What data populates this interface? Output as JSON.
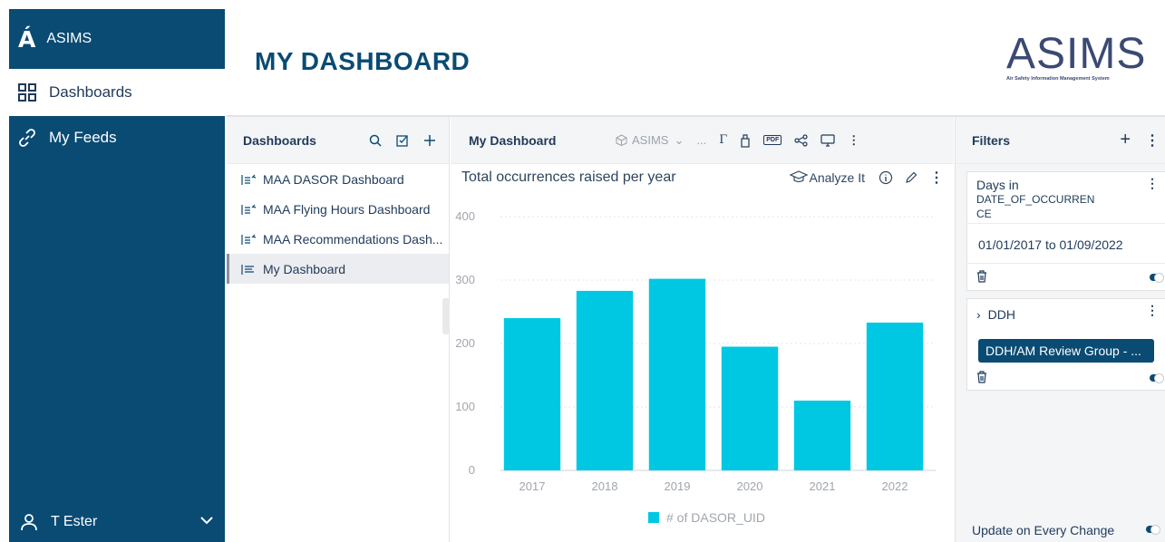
{
  "sidebar": {
    "brand": "ASIMS",
    "items": [
      {
        "label": "Dashboards",
        "icon": "grid-icon"
      },
      {
        "label": "My Feeds",
        "icon": "link-icon"
      }
    ],
    "user": "T Ester"
  },
  "header": {
    "title": "MY DASHBOARD",
    "logo_text": "ASIMS",
    "logo_subtitle": "Air Safety Information Management System"
  },
  "dashboards_panel": {
    "title": "Dashboards",
    "items": [
      {
        "label": "MAA DASOR Dashboard",
        "active": false
      },
      {
        "label": "MAA Flying Hours Dashboard",
        "active": false
      },
      {
        "label": "MAA Recommendations Dash...",
        "active": false
      },
      {
        "label": "My Dashboard",
        "active": true
      }
    ]
  },
  "dashboard": {
    "title": "My Dashboard",
    "source": "ASIMS",
    "ellipsis": "...",
    "pdf_label": "PDF",
    "widget": {
      "title": "Total occurrences raised per year",
      "analyze_label": "Analyze It"
    }
  },
  "chart_data": {
    "type": "bar",
    "categories": [
      "2017",
      "2018",
      "2019",
      "2020",
      "2021",
      "2022"
    ],
    "series": [
      {
        "name": "# of DASOR_UID",
        "values": [
          240,
          283,
          302,
          195,
          110,
          233
        ]
      }
    ],
    "yticks": [
      "0",
      "100",
      "200",
      "300",
      "400"
    ],
    "ylim": [
      0,
      400
    ],
    "grid": true,
    "legend_position": "bottom",
    "bar_color": "#00c8e3"
  },
  "filters": {
    "title": "Filters",
    "filter1": {
      "label_line1": "Days in",
      "label_line2": "DATE_OF_OCCURREN",
      "label_line3": "CE",
      "range": "01/01/2017 to 01/09/2022"
    },
    "filter2": {
      "label": "DDH",
      "chip": "DDH/AM Review Group - ..."
    },
    "update_label": "Update on Every Change"
  },
  "colors": {
    "sidebar": "#0a4b73",
    "accent": "#0a4b73",
    "bar": "#00c8e3"
  }
}
